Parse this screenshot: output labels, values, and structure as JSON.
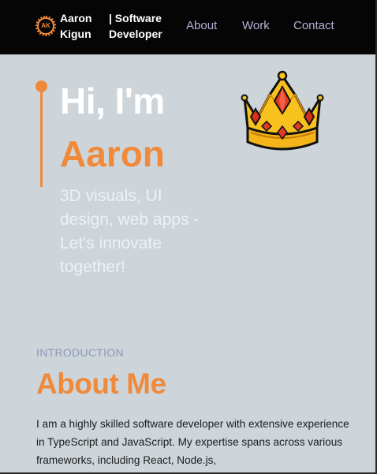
{
  "nav": {
    "logo_initials": "AK",
    "brand_name": "Aaron Kigun",
    "brand_role": "| Software Developer",
    "links": [
      {
        "label": "About"
      },
      {
        "label": "Work"
      },
      {
        "label": "Contact"
      }
    ]
  },
  "hero": {
    "greeting": "Hi, I'm",
    "name": "Aaron",
    "tagline": "3D visuals, UI design, web apps - Let's innovate together!",
    "crown_icon": "crown-icon"
  },
  "intro": {
    "eyebrow": "INTRODUCTION",
    "title": "About Me",
    "text": "I am a highly skilled software developer with extensive experience in TypeScript and JavaScript. My expertise spans across various frameworks, including React, Node.js,"
  },
  "colors": {
    "accent": "#f08a3a",
    "nav_bg": "#050505",
    "page_bg": "#cdd5da",
    "nav_link": "#b7b2d9"
  }
}
